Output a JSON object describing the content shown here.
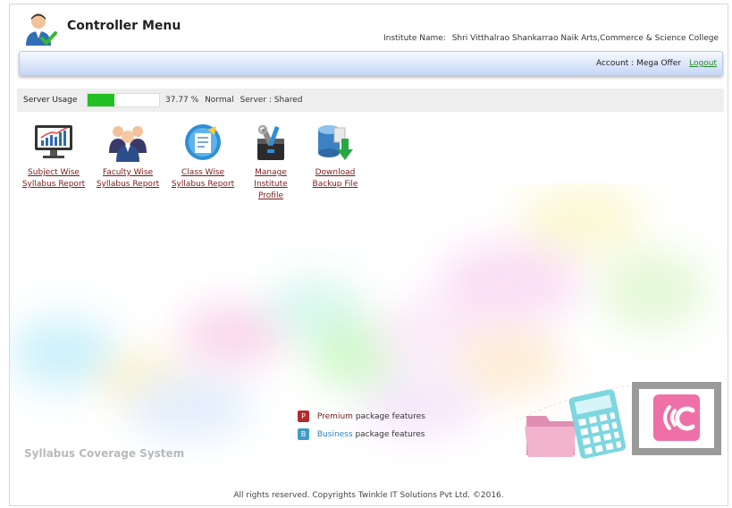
{
  "header": {
    "title": "Controller Menu",
    "institute_label": "Institute Name:",
    "institute_name": "Shri Vitthalrao Shankarrao Naik Arts,Commerce & Science College",
    "user_icon": "user-avatar-icon"
  },
  "account": {
    "label": "Account : Mega Offer",
    "logout": "Logout"
  },
  "usage": {
    "label": "Server Usage",
    "percent_text": "37.77 %",
    "percent": 37.77,
    "status": "Normal",
    "server": "Server : Shared",
    "fill_color": "#22c022"
  },
  "tiles": [
    {
      "line1": "Subject Wise",
      "line2": "Syllabus Report",
      "icon": "monitor-chart-icon"
    },
    {
      "line1": "Faculty Wise",
      "line2": "Syllabus Report",
      "icon": "group-users-icon"
    },
    {
      "line1": "Class Wise",
      "line2": "Syllabus Report",
      "icon": "class-report-icon"
    },
    {
      "line1": "Manage",
      "line2": "Institute",
      "line3": "Profile",
      "icon": "tools-box-icon"
    },
    {
      "line1": "Download",
      "line2": "Backup File",
      "icon": "database-download-icon"
    }
  ],
  "legend": {
    "premium_badge": "P",
    "premium_label": "Premium",
    "premium_suffix": "package features",
    "business_badge": "B",
    "business_label": "Business",
    "business_suffix": "package features"
  },
  "system_name": "Syllabus Coverage System",
  "footer": "All rights reserved. Copyrights Twinkle IT Solutions Pvt Ltd. ©2016.",
  "colors": {
    "accent_link": "#7a1c1c",
    "logout": "#2a8a2a",
    "bar_gradient": "#c5d6f7"
  }
}
